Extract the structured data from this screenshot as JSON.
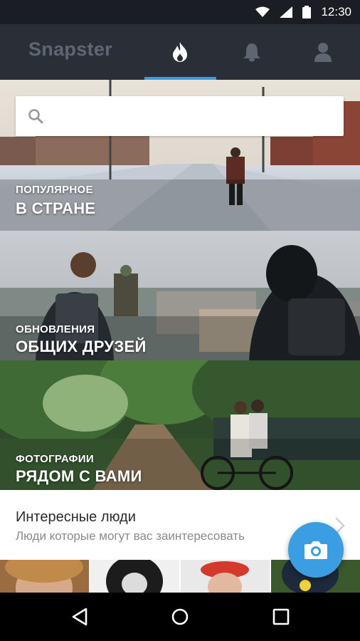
{
  "status_bar": {
    "time": "12:30",
    "icons": [
      "wifi-icon",
      "signal-icon",
      "battery-icon"
    ]
  },
  "app_bar": {
    "title": "Snapster",
    "tabs": [
      {
        "name": "popular",
        "icon": "flame-icon",
        "active": true
      },
      {
        "name": "notifications",
        "icon": "bell-icon",
        "active": false
      },
      {
        "name": "profile",
        "icon": "person-icon",
        "active": false
      }
    ],
    "accent_color": "#3b9be0"
  },
  "search": {
    "placeholder": "",
    "value": ""
  },
  "cards": [
    {
      "small": "ПОПУЛЯРНОЕ",
      "big": "В СТРАНЕ"
    },
    {
      "small": "ОБНОВЛЕНИЯ",
      "big": "ОБЩИХ ДРУЗЕЙ"
    },
    {
      "small": "ФОТОГРАФИИ",
      "big": "РЯДОМ С ВАМИ"
    }
  ],
  "people": {
    "title": "Интересные люди",
    "subtitle": "Люди которые могут вас заинтересовать"
  },
  "fab": {
    "icon": "camera-icon",
    "color": "#3c9ee2"
  },
  "nav_bar": {
    "icons": [
      "back-icon",
      "home-icon",
      "recents-icon"
    ]
  }
}
